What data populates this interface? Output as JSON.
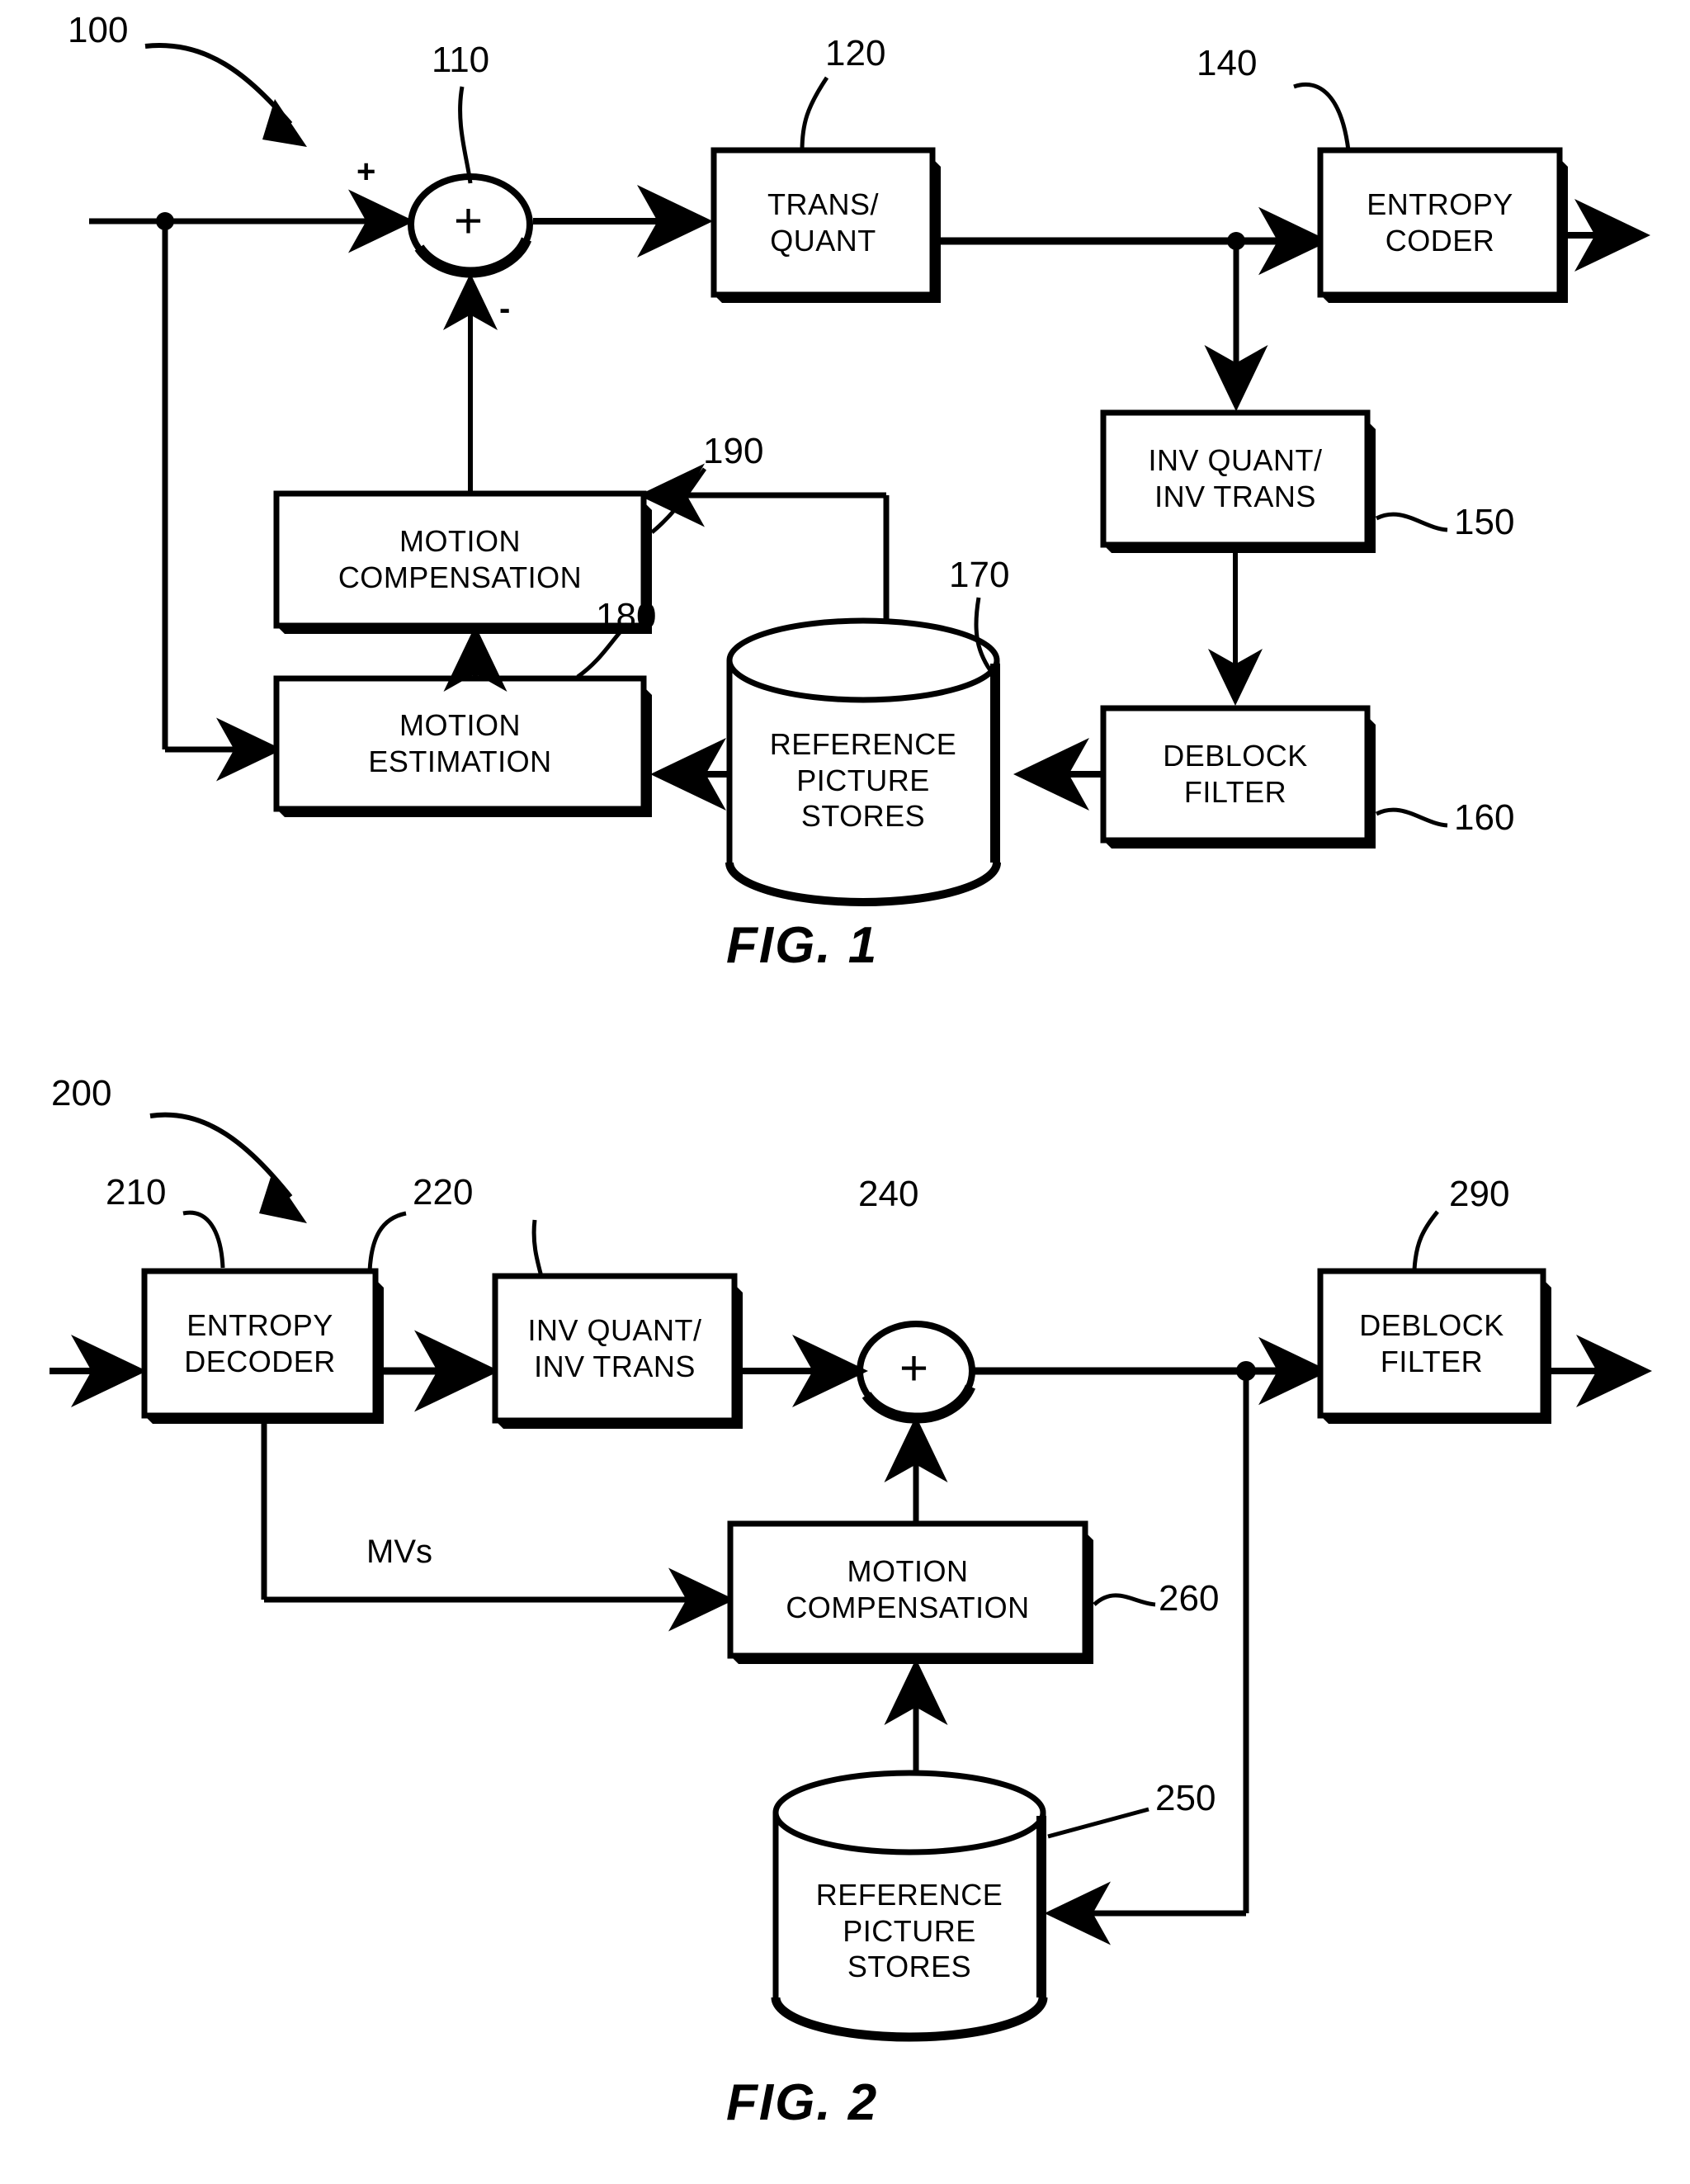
{
  "document": {
    "type": "patent-figure-sheet",
    "figures": [
      {
        "id": "fig1",
        "caption": "FIG. 1",
        "system_ref": "100",
        "title_semantic": "video encoder block diagram",
        "nodes": [
          {
            "key": "summer",
            "ref": "110",
            "shape": "circle",
            "glyph": "+",
            "label_lines": []
          },
          {
            "key": "trans_quant",
            "ref": "120",
            "shape": "box",
            "label_lines": [
              "TRANS/",
              "QUANT"
            ]
          },
          {
            "key": "entropy_coder",
            "ref": "140",
            "shape": "box",
            "label_lines": [
              "ENTROPY",
              "CODER"
            ]
          },
          {
            "key": "inv_quant_trans",
            "ref": "150",
            "shape": "box",
            "label_lines": [
              "INV QUANT/",
              "INV TRANS"
            ]
          },
          {
            "key": "deblock_filter",
            "ref": "160",
            "shape": "box",
            "label_lines": [
              "DEBLOCK",
              "FILTER"
            ]
          },
          {
            "key": "reference_picture_stores",
            "ref": "170",
            "shape": "cylinder",
            "label_lines": [
              "REFERENCE",
              "PICTURE",
              "STORES"
            ]
          },
          {
            "key": "motion_estimation",
            "ref": "180",
            "shape": "box",
            "label_lines": [
              "MOTION",
              "ESTIMATION"
            ]
          },
          {
            "key": "motion_compensation",
            "ref": "190",
            "shape": "box",
            "label_lines": [
              "MOTION",
              "COMPENSATION"
            ]
          }
        ],
        "signs": [
          {
            "key": "plus_input",
            "text": "+"
          },
          {
            "key": "minus_input",
            "text": "-"
          }
        ],
        "edge_labels": []
      },
      {
        "id": "fig2",
        "caption": "FIG. 2",
        "system_ref": "200",
        "title_semantic": "video decoder block diagram",
        "nodes": [
          {
            "key": "entropy_decoder",
            "ref": "210",
            "shape": "box",
            "label_lines": [
              "ENTROPY",
              "DECODER"
            ]
          },
          {
            "key": "inv_quant_trans",
            "ref": "220",
            "shape": "box",
            "label_lines": [
              "INV QUANT/",
              "INV TRANS"
            ]
          },
          {
            "key": "summer",
            "ref": "240",
            "shape": "circle",
            "glyph": "+",
            "label_lines": []
          },
          {
            "key": "deblock_filter",
            "ref": "290",
            "shape": "box",
            "label_lines": [
              "DEBLOCK",
              "FILTER"
            ]
          },
          {
            "key": "motion_compensation",
            "ref": "260",
            "shape": "box",
            "label_lines": [
              "MOTION",
              "COMPENSATION"
            ]
          },
          {
            "key": "reference_picture_stores",
            "ref": "250",
            "shape": "cylinder",
            "label_lines": [
              "REFERENCE",
              "PICTURE",
              "STORES"
            ]
          }
        ],
        "signs": [],
        "edge_labels": [
          {
            "key": "mvs",
            "text": "MVs"
          }
        ]
      }
    ],
    "colors": {
      "ink": "#000000",
      "paper": "#ffffff"
    }
  },
  "fig1": {
    "caption": "FIG. 1",
    "ref_system": "100",
    "ref_summer": "110",
    "ref_trans_quant": "120",
    "ref_entropy_coder": "140",
    "ref_inv_quant_trans": "150",
    "ref_deblock_filter": "160",
    "ref_reference_picture_stores": "170",
    "ref_motion_estimation": "180",
    "ref_motion_compensation": "190",
    "summer_glyph": "+",
    "sign_plus": "+",
    "sign_minus": "-",
    "trans_quant_l1": "TRANS/",
    "trans_quant_l2": "QUANT",
    "entropy_coder_l1": "ENTROPY",
    "entropy_coder_l2": "CODER",
    "inv_quant_trans_l1": "INV QUANT/",
    "inv_quant_trans_l2": "INV TRANS",
    "deblock_filter_l1": "DEBLOCK",
    "deblock_filter_l2": "FILTER",
    "rps_l1": "REFERENCE",
    "rps_l2": "PICTURE",
    "rps_l3": "STORES",
    "motion_estimation_l1": "MOTION",
    "motion_estimation_l2": "ESTIMATION",
    "motion_compensation_l1": "MOTION",
    "motion_compensation_l2": "COMPENSATION"
  },
  "fig2": {
    "caption": "FIG. 2",
    "ref_system": "200",
    "ref_entropy_decoder": "210",
    "ref_inv_quant_trans": "220",
    "ref_summer": "240",
    "ref_reference_picture_stores": "250",
    "ref_motion_compensation": "260",
    "ref_deblock_filter": "290",
    "summer_glyph": "+",
    "mvs_label": "MVs",
    "entropy_decoder_l1": "ENTROPY",
    "entropy_decoder_l2": "DECODER",
    "inv_quant_trans_l1": "INV QUANT/",
    "inv_quant_trans_l2": "INV TRANS",
    "deblock_filter_l1": "DEBLOCK",
    "deblock_filter_l2": "FILTER",
    "motion_compensation_l1": "MOTION",
    "motion_compensation_l2": "COMPENSATION",
    "rps_l1": "REFERENCE",
    "rps_l2": "PICTURE",
    "rps_l3": "STORES"
  }
}
